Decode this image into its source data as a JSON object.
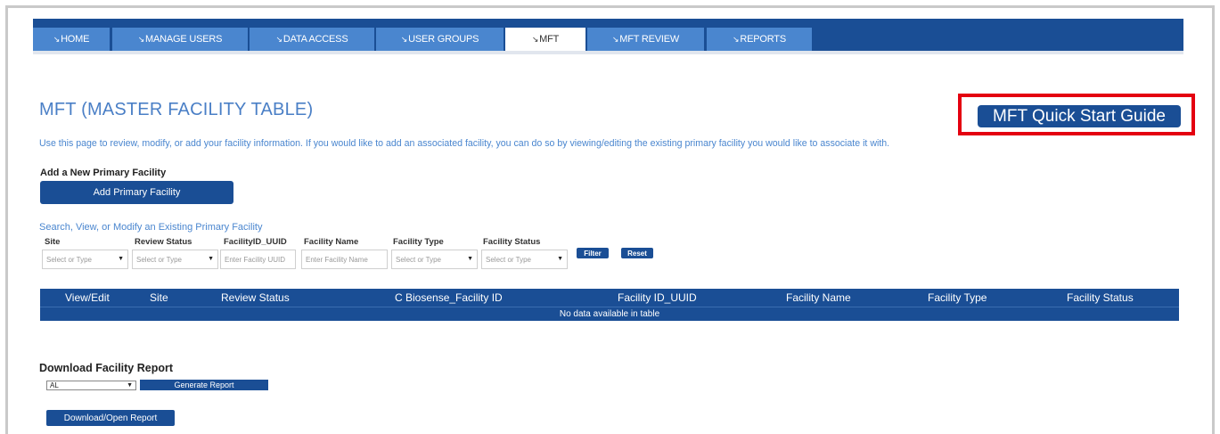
{
  "nav": {
    "tabs": [
      {
        "label": "HOME",
        "active": false
      },
      {
        "label": "MANAGE USERS",
        "active": false
      },
      {
        "label": "DATA ACCESS",
        "active": false
      },
      {
        "label": "USER GROUPS",
        "active": false
      },
      {
        "label": "MFT",
        "active": true
      },
      {
        "label": "MFT REVIEW",
        "active": false
      },
      {
        "label": "REPORTS",
        "active": false
      }
    ],
    "arrow_icon": "nav-arrow-icon"
  },
  "page": {
    "title": "MFT (MASTER FACILITY TABLE)",
    "quick_start_label": "MFT Quick Start Guide",
    "intro": "Use this page to review, modify, or add your facility information. If you would like to add an associated facility, you can do so by viewing/editing the existing primary facility you would like to associate it with."
  },
  "add_section": {
    "heading": "Add a New Primary Facility",
    "button_label": "Add Primary Facility"
  },
  "search": {
    "title": "Search, View, or Modify an Existing Primary Facility",
    "filters": [
      {
        "label": "Site",
        "placeholder": "Select or Type",
        "type": "select"
      },
      {
        "label": "Review Status",
        "placeholder": "Select or Type",
        "type": "select"
      },
      {
        "label": "FacilityID_UUID",
        "placeholder": "Enter Facility UUID",
        "type": "text"
      },
      {
        "label": "Facility Name",
        "placeholder": "Enter Facility Name",
        "type": "text"
      },
      {
        "label": "Facility Type",
        "placeholder": "Select or Type",
        "type": "select"
      },
      {
        "label": "Facility Status",
        "placeholder": "Select or Type",
        "type": "select"
      }
    ],
    "filter_label": "Filter",
    "reset_label": "Reset"
  },
  "table": {
    "columns": [
      "View/Edit",
      "Site",
      "Review Status",
      "C Biosense_Facility ID",
      "Facility ID_UUID",
      "Facility Name",
      "Facility Type",
      "Facility Status"
    ],
    "empty_message": "No data available in table"
  },
  "download": {
    "heading": "Download Facility Report",
    "state_value": "AL",
    "generate_label": "Generate Report",
    "download_label": "Download/Open Report"
  },
  "colors": {
    "primary": "#1a4e95",
    "tab": "#4a86cf",
    "highlight_border": "#e40010",
    "link_text": "#4a86cf"
  }
}
